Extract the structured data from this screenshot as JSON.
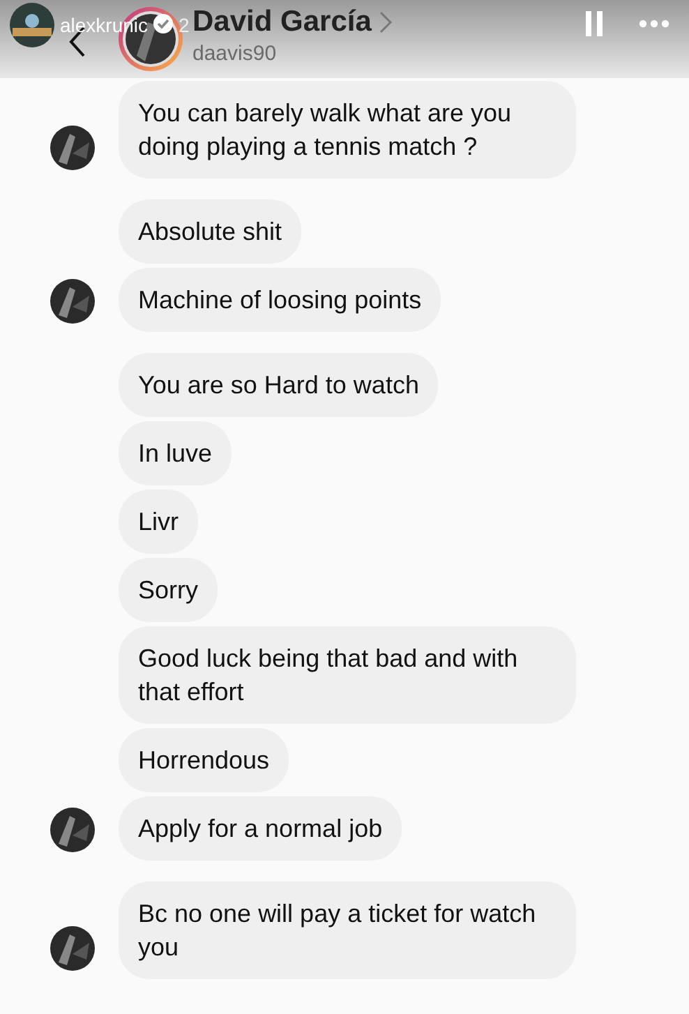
{
  "story": {
    "username": "alexkrunic",
    "verified": true,
    "time": "2"
  },
  "header": {
    "name": "David García",
    "username": "daavis90"
  },
  "groups": [
    {
      "messages": [
        "You can barely walk what are you doing playing a tennis match ?"
      ]
    },
    {
      "messages": [
        "Absolute shit",
        "Machine of loosing points"
      ]
    },
    {
      "messages": [
        "You are so Hard to watch",
        "In luve",
        "Livr",
        "Sorry",
        "Good luck being that bad and with that effort",
        "Horrendous",
        "Apply for a normal job"
      ]
    },
    {
      "messages": [
        "Bc no one will pay a ticket for watch you"
      ]
    }
  ]
}
